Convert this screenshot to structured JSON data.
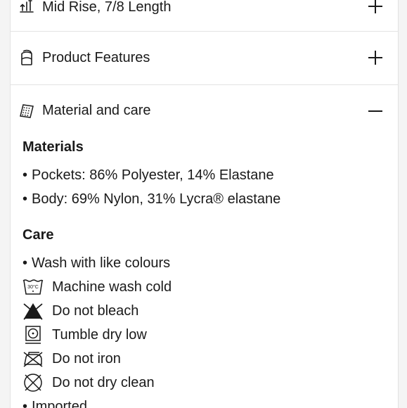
{
  "accordion": {
    "items": [
      {
        "label": "Mid Rise, 7/8 Length",
        "icon": "rise-length-icon",
        "state": "collapsed"
      },
      {
        "label": "Product Features",
        "icon": "product-features-icon",
        "state": "collapsed"
      },
      {
        "label": "Material and care",
        "icon": "fabric-swatch-icon",
        "state": "expanded"
      }
    ]
  },
  "materials": {
    "heading": "Materials",
    "items": [
      "Pockets: 86% Polyester, 14% Elastane",
      "Body: 69% Nylon, 31% Lycra® elastane"
    ]
  },
  "care": {
    "heading": "Care",
    "intro": "Wash with like colours",
    "symbols": [
      {
        "label": "Machine wash cold",
        "icon": "machine-wash-30c-icon",
        "temp": "30°C"
      },
      {
        "label": "Do not bleach",
        "icon": "do-not-bleach-icon"
      },
      {
        "label": "Tumble dry low",
        "icon": "tumble-dry-low-icon"
      },
      {
        "label": "Do not iron",
        "icon": "do-not-iron-icon"
      },
      {
        "label": "Do not dry clean",
        "icon": "do-not-dry-clean-icon"
      }
    ],
    "extra": "Imported"
  },
  "colors": {
    "text": "#1a1a1a",
    "divider": "#e3e3e3",
    "background": "#ffffff",
    "page": "#f4f4f4"
  }
}
